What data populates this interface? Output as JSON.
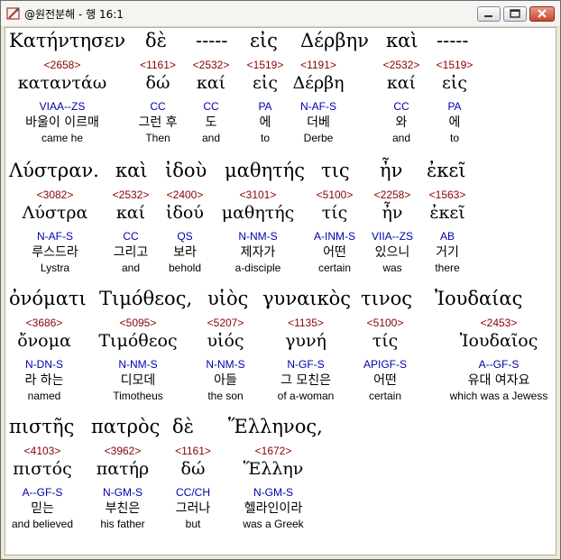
{
  "window": {
    "title": "@원전분해 - 행 16:1",
    "icon": "pen-book-icon"
  },
  "lines": [
    {
      "words": [
        {
          "text": "Κατήντησεν",
          "strong": "<2658>",
          "lexeme": "καταντάω",
          "parse": "VIAA--ZS",
          "korean": "바울이 이르매",
          "english": "came he"
        },
        {
          "text": "δὲ",
          "strong": "<1161>",
          "lexeme": "δώ",
          "parse": "CC",
          "korean": "그런 후",
          "english": "Then"
        },
        {
          "text": "-----",
          "strong": "<2532>",
          "lexeme": "καί",
          "parse": "CC",
          "korean": "도",
          "english": "and"
        },
        {
          "text": "εἰς",
          "strong": "<1519>",
          "lexeme": "εἰς",
          "parse": "PA",
          "korean": "에",
          "english": "to"
        },
        {
          "text": "Δέρβην",
          "strong": "<1191>",
          "lexeme": "Δέρβη",
          "parse": "N-AF-S",
          "korean": "더베",
          "english": "Derbe"
        },
        {
          "text": "καὶ",
          "strong": "<2532>",
          "lexeme": "καί",
          "parse": "CC",
          "korean": "와",
          "english": "and"
        },
        {
          "text": "-----",
          "strong": "<1519>",
          "lexeme": "εἰς",
          "parse": "PA",
          "korean": "에",
          "english": "to"
        }
      ]
    },
    {
      "words": [
        {
          "text": "Λύστραν.",
          "strong": "<3082>",
          "lexeme": "Λύστρα",
          "parse": "N-AF-S",
          "korean": "루스드라",
          "english": "Lystra"
        },
        {
          "text": "καὶ",
          "strong": "<2532>",
          "lexeme": "καί",
          "parse": "CC",
          "korean": "그리고",
          "english": "and"
        },
        {
          "text": "ἰδοὺ",
          "strong": "<2400>",
          "lexeme": "ἰδού",
          "parse": "QS",
          "korean": "보라",
          "english": "behold"
        },
        {
          "text": "μαθητής",
          "strong": "<3101>",
          "lexeme": "μαθητής",
          "parse": "N-NM-S",
          "korean": "제자가",
          "english": "a-disciple"
        },
        {
          "text": "τις",
          "strong": "<5100>",
          "lexeme": "τίς",
          "parse": "A-INM-S",
          "korean": "어떤",
          "english": "certain"
        },
        {
          "text": "ἦν",
          "strong": "<2258>",
          "lexeme": "ἦν",
          "parse": "VIIA--ZS",
          "korean": "있으니",
          "english": "was"
        },
        {
          "text": "ἐκεῖ",
          "strong": "<1563>",
          "lexeme": "ἐκεῖ",
          "parse": "AB",
          "korean": "거기",
          "english": "there"
        }
      ]
    },
    {
      "words": [
        {
          "text": "ὀνόματι",
          "strong": "<3686>",
          "lexeme": "ὄνομα",
          "parse": "N-DN-S",
          "korean": "라 하는",
          "english": "named"
        },
        {
          "text": "Τιμόθεος,",
          "strong": "<5095>",
          "lexeme": "Τιμόθεος",
          "parse": "N-NM-S",
          "korean": "디모데",
          "english": "Timotheus"
        },
        {
          "text": "υἱὸς",
          "strong": "<5207>",
          "lexeme": "υἱός",
          "parse": "N-NM-S",
          "korean": "아들",
          "english": "the son"
        },
        {
          "text": "γυναικὸς",
          "strong": "<1135>",
          "lexeme": "γυνή",
          "parse": "N-GF-S",
          "korean": "그 모친은",
          "english": "of a-woman"
        },
        {
          "text": "τινος",
          "strong": "<5100>",
          "lexeme": "τίς",
          "parse": "APIGF-S",
          "korean": "어떤",
          "english": "certain"
        },
        {
          "text": "Ἰουδαίας",
          "strong": "<2453>",
          "lexeme": "Ἰουδαῖος",
          "parse": "A--GF-S",
          "korean": "유대 여자요",
          "english": "which was a Jewess"
        }
      ]
    },
    {
      "words": [
        {
          "text": "πιστῆς",
          "strong": "<4103>",
          "lexeme": "πιστός",
          "parse": "A--GF-S",
          "korean": "믿는",
          "english": "and believed"
        },
        {
          "text": "πατρὸς",
          "strong": "<3962>",
          "lexeme": "πατήρ",
          "parse": "N-GM-S",
          "korean": "부친은",
          "english": "his father"
        },
        {
          "text": "δὲ",
          "strong": "<1161>",
          "lexeme": "δώ",
          "parse": "CC/CH",
          "korean": "그러나",
          "english": "but"
        },
        {
          "text": "Ἕλληνος,",
          "strong": "<1672>",
          "lexeme": "Ἕλλην",
          "parse": "N-GM-S",
          "korean": "헬라인이라",
          "english": "was a Greek"
        }
      ]
    }
  ],
  "colors": {
    "strong": "#8b0000",
    "parse": "#0000aa",
    "text": "#000000"
  }
}
